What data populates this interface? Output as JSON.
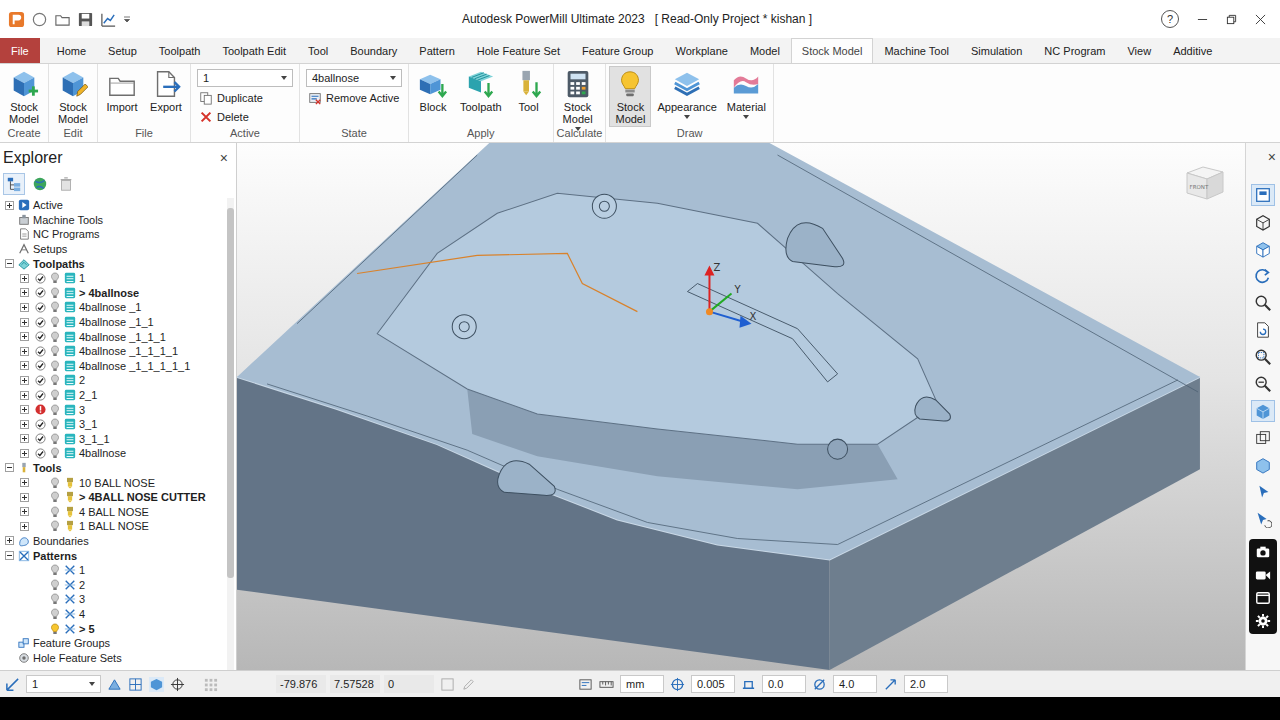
{
  "window": {
    "title": "Autodesk PowerMill Ultimate 2023   [ Read-Only Project * kishan ]",
    "help": "?"
  },
  "menu": {
    "file": "File",
    "tabs": [
      {
        "label": "Home",
        "selected": false
      },
      {
        "label": "Setup",
        "selected": false
      },
      {
        "label": "Toolpath",
        "selected": false
      },
      {
        "label": "Toolpath Edit",
        "selected": false
      },
      {
        "label": "Tool",
        "selected": false
      },
      {
        "label": "Boundary",
        "selected": false
      },
      {
        "label": "Pattern",
        "selected": false
      },
      {
        "label": "Hole Feature Set",
        "selected": false
      },
      {
        "label": "Feature Group",
        "selected": false
      },
      {
        "label": "Workplane",
        "selected": false
      },
      {
        "label": "Model",
        "selected": false
      },
      {
        "label": "Stock Model",
        "selected": true
      },
      {
        "label": "Machine Tool",
        "selected": false
      },
      {
        "label": "Simulation",
        "selected": false
      },
      {
        "label": "NC Program",
        "selected": false
      },
      {
        "label": "View",
        "selected": false
      },
      {
        "label": "Additive",
        "selected": false
      }
    ]
  },
  "ribbon": {
    "groups": [
      {
        "label": "Create",
        "items": [
          {
            "kind": "large",
            "label": "Stock Model",
            "menu": false
          }
        ]
      },
      {
        "label": "Edit",
        "items": [
          {
            "kind": "large",
            "label": "Stock Model",
            "menu": false
          }
        ]
      },
      {
        "label": "File",
        "items": [
          {
            "kind": "large",
            "label": "Import",
            "menu": false
          },
          {
            "kind": "large",
            "label": "Export",
            "menu": false
          }
        ]
      },
      {
        "label": "Active",
        "items": [
          {
            "kind": "dropdown",
            "value": "1"
          },
          {
            "kind": "small",
            "label": "Duplicate"
          },
          {
            "kind": "small",
            "label": "Delete"
          }
        ]
      },
      {
        "label": "State",
        "items": [
          {
            "kind": "dropdown",
            "value": "4ballnose"
          },
          {
            "kind": "small",
            "label": "Remove Active"
          }
        ]
      },
      {
        "label": "Apply",
        "items": [
          {
            "kind": "large",
            "label": "Block",
            "menu": false
          },
          {
            "kind": "large",
            "label": "Toolpath",
            "menu": false
          },
          {
            "kind": "large",
            "label": "Tool",
            "menu": false
          }
        ]
      },
      {
        "label": "Calculate",
        "items": [
          {
            "kind": "large",
            "label": "Stock Model",
            "menu": true
          }
        ]
      },
      {
        "label": "Draw",
        "items": [
          {
            "kind": "large",
            "label": "Stock Model",
            "menu": false,
            "on": true
          },
          {
            "kind": "large",
            "label": "Appearance",
            "menu": true,
            "on": false
          },
          {
            "kind": "large",
            "label": "Material",
            "menu": true,
            "on": false
          }
        ]
      }
    ]
  },
  "explorer": {
    "title": "Explorer",
    "close": "×",
    "scrollbar_level": 0.8,
    "toolbar": [
      {
        "selected": true
      },
      {
        "selected": false
      },
      {
        "selected": false
      }
    ],
    "tree": [
      {
        "label": "Active",
        "level": 0,
        "kind": "root",
        "expandable": true,
        "expanded": false,
        "bold": false
      },
      {
        "label": "Machine Tools",
        "level": 0,
        "kind": "root",
        "expandable": false,
        "expanded": false,
        "bold": false
      },
      {
        "label": "NC Programs",
        "level": 0,
        "kind": "root",
        "expandable": false,
        "expanded": false,
        "bold": false
      },
      {
        "label": "Setups",
        "level": 0,
        "kind": "root",
        "expandable": false,
        "expanded": false,
        "bold": false
      },
      {
        "label": "Toolpaths",
        "level": 0,
        "kind": "root",
        "expandable": true,
        "expanded": true,
        "bold": true
      },
      {
        "label": "1",
        "level": 1,
        "kind": "toolpath",
        "expandable": true,
        "expanded": false,
        "checked": true,
        "error": false,
        "lit": false,
        "bold": false
      },
      {
        "label": "> 4ballnose",
        "level": 1,
        "kind": "toolpath",
        "expandable": true,
        "expanded": false,
        "checked": true,
        "error": false,
        "lit": false,
        "bold": true
      },
      {
        "label": "4ballnose _1",
        "level": 1,
        "kind": "toolpath",
        "expandable": true,
        "expanded": false,
        "checked": true,
        "error": false,
        "lit": false,
        "bold": false
      },
      {
        "label": "4ballnose _1_1",
        "level": 1,
        "kind": "toolpath",
        "expandable": true,
        "expanded": false,
        "checked": true,
        "error": false,
        "lit": false,
        "bold": false
      },
      {
        "label": "4ballnose _1_1_1",
        "level": 1,
        "kind": "toolpath",
        "expandable": true,
        "expanded": false,
        "checked": true,
        "error": false,
        "lit": false,
        "bold": false
      },
      {
        "label": "4ballnose _1_1_1_1",
        "level": 1,
        "kind": "toolpath",
        "expandable": true,
        "expanded": false,
        "checked": true,
        "error": false,
        "lit": false,
        "bold": false
      },
      {
        "label": "4ballnose _1_1_1_1_1",
        "level": 1,
        "kind": "toolpath",
        "expandable": true,
        "expanded": false,
        "checked": true,
        "error": false,
        "lit": false,
        "bold": false
      },
      {
        "label": "2",
        "level": 1,
        "kind": "toolpath",
        "expandable": true,
        "expanded": false,
        "checked": true,
        "error": false,
        "lit": false,
        "bold": false
      },
      {
        "label": "2_1",
        "level": 1,
        "kind": "toolpath",
        "expandable": true,
        "expanded": false,
        "checked": true,
        "error": false,
        "lit": false,
        "bold": false
      },
      {
        "label": "3",
        "level": 1,
        "kind": "toolpath",
        "expandable": true,
        "expanded": false,
        "checked": false,
        "error": true,
        "lit": false,
        "bold": false
      },
      {
        "label": "3_1",
        "level": 1,
        "kind": "toolpath",
        "expandable": true,
        "expanded": false,
        "checked": true,
        "error": false,
        "lit": false,
        "bold": false
      },
      {
        "label": "3_1_1",
        "level": 1,
        "kind": "toolpath",
        "expandable": true,
        "expanded": false,
        "checked": true,
        "error": false,
        "lit": false,
        "bold": false
      },
      {
        "label": "4ballnose",
        "level": 1,
        "kind": "toolpath",
        "expandable": true,
        "expanded": false,
        "checked": true,
        "error": false,
        "lit": false,
        "bold": false
      },
      {
        "label": "Tools",
        "level": 0,
        "kind": "root",
        "expandable": true,
        "expanded": true,
        "bold": true
      },
      {
        "label": "10 BALL NOSE",
        "level": 1,
        "kind": "tool",
        "expandable": true,
        "expanded": false,
        "lit": false,
        "bold": false
      },
      {
        "label": "> 4BALL NOSE CUTTER",
        "level": 1,
        "kind": "tool",
        "expandable": true,
        "expanded": false,
        "lit": false,
        "bold": true
      },
      {
        "label": "4 BALL NOSE",
        "level": 1,
        "kind": "tool",
        "expandable": true,
        "expanded": false,
        "lit": false,
        "bold": false
      },
      {
        "label": "1 BALL NOSE",
        "level": 1,
        "kind": "tool",
        "expandable": true,
        "expanded": false,
        "lit": false,
        "bold": false
      },
      {
        "label": "Boundaries",
        "level": 0,
        "kind": "root",
        "expandable": true,
        "expanded": false,
        "bold": false
      },
      {
        "label": "Patterns",
        "level": 0,
        "kind": "root",
        "expandable": true,
        "expanded": true,
        "bold": true
      },
      {
        "label": "1",
        "level": 1,
        "kind": "pattern",
        "expandable": false,
        "expanded": false,
        "lit": false,
        "bold": false
      },
      {
        "label": "2",
        "level": 1,
        "kind": "pattern",
        "expandable": false,
        "expanded": false,
        "lit": false,
        "bold": false
      },
      {
        "label": "3",
        "level": 1,
        "kind": "pattern",
        "expandable": false,
        "expanded": false,
        "lit": false,
        "bold": false
      },
      {
        "label": "4",
        "level": 1,
        "kind": "pattern",
        "expandable": false,
        "expanded": false,
        "lit": false,
        "bold": false
      },
      {
        "label": "> 5",
        "level": 1,
        "kind": "pattern",
        "expandable": false,
        "expanded": false,
        "lit": true,
        "bold": true
      },
      {
        "label": "Feature Groups",
        "level": 0,
        "kind": "root",
        "expandable": false,
        "expanded": false,
        "bold": false
      },
      {
        "label": "Hole Feature Sets",
        "level": 0,
        "kind": "root",
        "expandable": false,
        "expanded": false,
        "bold": false
      }
    ]
  },
  "viewport": {
    "axes": {
      "z": "Z",
      "y": "Y",
      "x": "X"
    },
    "viewcube": "FRONT",
    "close": "×",
    "toolbar": [
      {
        "selected": true
      },
      {
        "selected": false
      },
      {
        "selected": false
      },
      {
        "selected": false
      },
      {
        "selected": false
      },
      {
        "selected": false
      },
      {
        "selected": false
      },
      {
        "selected": false
      },
      {
        "selected": true
      },
      {
        "selected": false
      },
      {
        "selected": false
      },
      {
        "selected": false
      },
      {
        "selected": false
      }
    ]
  },
  "status_bar": {
    "workplane": "1",
    "coords": [
      "-79.876",
      "7.57528",
      "0"
    ],
    "units": "mm",
    "tolerance": "0.005",
    "thickness": "0.0",
    "diameter": "4.0",
    "stepover": "2.0"
  }
}
